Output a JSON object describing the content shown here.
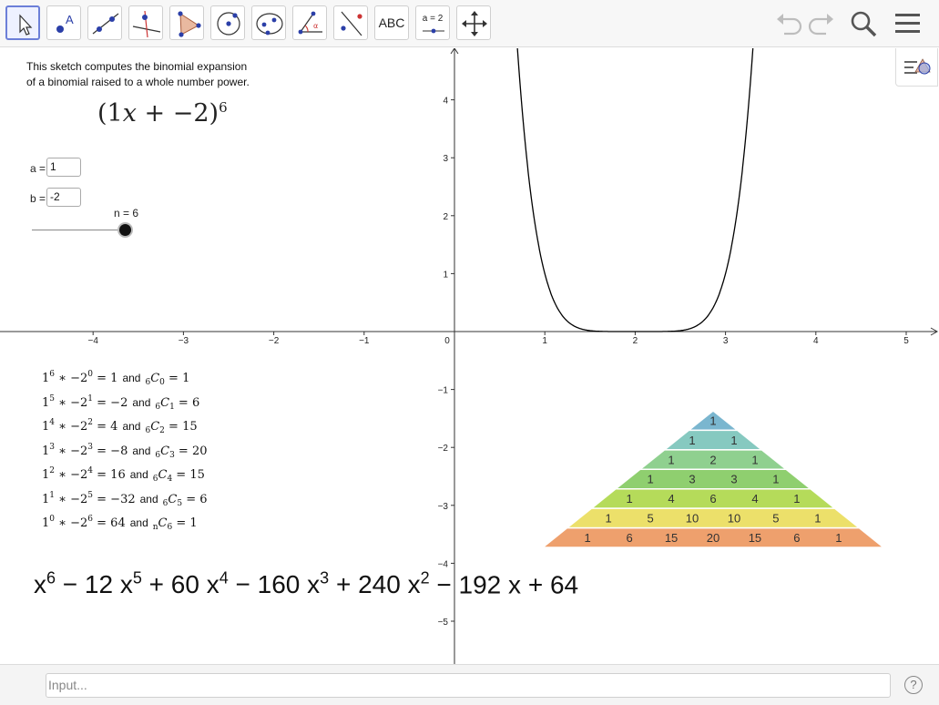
{
  "toolbar": {
    "tools": [
      {
        "name": "move",
        "label": ""
      },
      {
        "name": "point",
        "label": ""
      },
      {
        "name": "line",
        "label": ""
      },
      {
        "name": "perpendicular-line",
        "label": ""
      },
      {
        "name": "polygon",
        "label": ""
      },
      {
        "name": "circle-center-point",
        "label": ""
      },
      {
        "name": "conic",
        "label": ""
      },
      {
        "name": "angle",
        "label": ""
      },
      {
        "name": "reflect",
        "label": ""
      },
      {
        "name": "text",
        "label": "ABC"
      },
      {
        "name": "slider",
        "label": "a = 2"
      },
      {
        "name": "move-graphics-view",
        "label": ""
      }
    ],
    "right": [
      "undo-icon",
      "redo-icon",
      "search-icon",
      "menu-icon"
    ]
  },
  "description": {
    "line1": "This sketch computes the binomial expansion",
    "line2": "of a binomial raised to a whole number power."
  },
  "expression": {
    "open": "(1",
    "var": "x",
    "plus": " + −2)",
    "power": "6"
  },
  "fields": {
    "a_label": "a =",
    "a_value": "1",
    "b_label": "b =",
    "b_value": "-2",
    "n_label": "n = 6"
  },
  "slider": {
    "min": 0,
    "max": 6,
    "value": 6
  },
  "terms": [
    {
      "lhs_base": "1",
      "lhs_exp": "6",
      "b_base": "−2",
      "b_exp": "0",
      "lhs_val": "1",
      "and": "and",
      "c_n": "6",
      "c_k": "0",
      "c_val": "1"
    },
    {
      "lhs_base": "1",
      "lhs_exp": "5",
      "b_base": "−2",
      "b_exp": "1",
      "lhs_val": "−2",
      "and": "and",
      "c_n": "6",
      "c_k": "1",
      "c_val": "6"
    },
    {
      "lhs_base": "1",
      "lhs_exp": "4",
      "b_base": "−2",
      "b_exp": "2",
      "lhs_val": "4",
      "and": "and",
      "c_n": "6",
      "c_k": "2",
      "c_val": "15"
    },
    {
      "lhs_base": "1",
      "lhs_exp": "3",
      "b_base": "−2",
      "b_exp": "3",
      "lhs_val": "−8",
      "and": "and",
      "c_n": "6",
      "c_k": "3",
      "c_val": "20"
    },
    {
      "lhs_base": "1",
      "lhs_exp": "2",
      "b_base": "−2",
      "b_exp": "4",
      "lhs_val": "16",
      "and": "and",
      "c_n": "6",
      "c_k": "4",
      "c_val": "15"
    },
    {
      "lhs_base": "1",
      "lhs_exp": "1",
      "b_base": "−2",
      "b_exp": "5",
      "lhs_val": "−32",
      "and": "and",
      "c_n": "6",
      "c_k": "5",
      "c_val": "6"
    },
    {
      "lhs_base": "1",
      "lhs_exp": "0",
      "b_base": "−2",
      "b_exp": "6",
      "lhs_val": "64",
      "and": "and",
      "c_n": "n",
      "c_k": "6",
      "c_val": "1"
    }
  ],
  "result": [
    {
      "coef": "",
      "var": "x",
      "exp": "6"
    },
    {
      "coef": "− 12 ",
      "var": "x",
      "exp": "5"
    },
    {
      "coef": "+ 60 ",
      "var": "x",
      "exp": "4"
    },
    {
      "coef": "− 160 ",
      "var": "x",
      "exp": "3"
    },
    {
      "coef": "+ 240 ",
      "var": "x",
      "exp": "2"
    },
    {
      "coef": "− 192 ",
      "var": "x",
      "exp": ""
    },
    {
      "coef": "+ 64",
      "var": "",
      "exp": ""
    }
  ],
  "graph": {
    "x_ticks": [
      "−4",
      "−3",
      "−2",
      "−1",
      "0",
      "1",
      "2",
      "3",
      "4",
      "5"
    ],
    "y_ticks_pos": [
      "1",
      "2",
      "3",
      "4"
    ],
    "y_ticks_neg": [
      "−1",
      "−2",
      "−3",
      "−4",
      "−5"
    ],
    "curve_color": "#000000",
    "function": "(x-2)^6"
  },
  "pascal": {
    "rows": [
      [
        "1"
      ],
      [
        "1",
        "1"
      ],
      [
        "1",
        "2",
        "1"
      ],
      [
        "1",
        "3",
        "3",
        "1"
      ],
      [
        "1",
        "4",
        "6",
        "4",
        "1"
      ],
      [
        "1",
        "5",
        "10",
        "10",
        "5",
        "1"
      ],
      [
        "1",
        "6",
        "15",
        "20",
        "15",
        "6",
        "1"
      ]
    ],
    "colors": [
      "#7ab6cf",
      "#86c9c0",
      "#8fd08f",
      "#8fcf6f",
      "#b5db5a",
      "#ece06a",
      "#eea06d"
    ]
  },
  "input": {
    "placeholder": "Input..."
  },
  "help": "?"
}
